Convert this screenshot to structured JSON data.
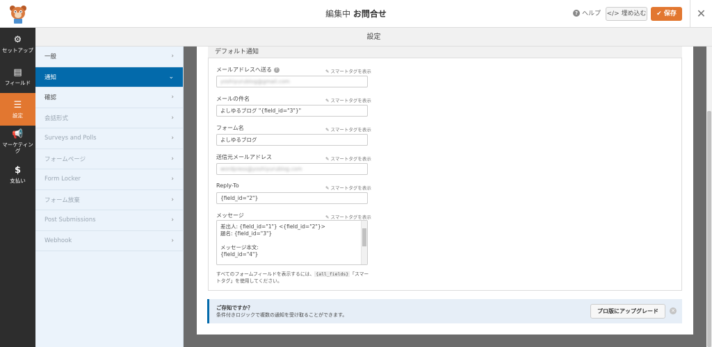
{
  "header": {
    "title_prefix": "編集中",
    "form_name": "お問合せ",
    "help_label": "ヘルプ",
    "embed_label": "</> 埋め込む",
    "save_label": "✔ 保存"
  },
  "sidebar": {
    "items": [
      {
        "icon": "⚙",
        "label": "セットアップ",
        "icon_name": "gear-icon"
      },
      {
        "icon": "▤",
        "label": "フィールド",
        "icon_name": "fields-list-icon"
      },
      {
        "icon": "☰",
        "label": "設定",
        "icon_name": "sliders-icon"
      },
      {
        "icon": "📢",
        "label": "マーケティング",
        "icon_name": "megaphone-icon"
      },
      {
        "icon": "$",
        "label": "支払い",
        "icon_name": "dollar-icon"
      }
    ],
    "active_index": 2
  },
  "subheader": {
    "label": "設定"
  },
  "panel": {
    "items": [
      {
        "label": "一般",
        "chev": "›"
      },
      {
        "label": "通知",
        "chev": "⌄"
      },
      {
        "label": "確認",
        "chev": "›"
      },
      {
        "label": "会話形式",
        "chev": "›"
      },
      {
        "label": "Surveys and Polls",
        "chev": "›"
      },
      {
        "label": "フォームページ",
        "chev": "›"
      },
      {
        "label": "Form Locker",
        "chev": "›"
      },
      {
        "label": "フォーム放棄",
        "chev": "›"
      },
      {
        "label": "Post Submissions",
        "chev": "›"
      },
      {
        "label": "Webhook",
        "chev": "›"
      }
    ]
  },
  "notification": {
    "heading": "デフォルト通知",
    "smart_tag_label": "スマートタグを表示",
    "fields": [
      {
        "label": "メールアドレスへ送る",
        "value": "yoshiyurublog@gmail.com"
      },
      {
        "label": "メールの件名",
        "value": "よしゆるブログ \"{field_id=\"3\"}\""
      },
      {
        "label": "フォーム名",
        "value": "よしゆるブログ"
      },
      {
        "label": "送信元メールアドレス",
        "value": "wordpress@yoshiyurublog.com"
      },
      {
        "label": "Reply-To",
        "value": "{field_id=\"2\"}"
      }
    ],
    "message": {
      "label": "メッセージ",
      "value": "差出人: {field_id=\"1\"} <{field_id=\"2\"}>\n題名: {field_id=\"3\"}\n\nメッセージ本文:\n{field_id=\"4\"}"
    },
    "note_before": "すべてのフォームフィールドを表示するには、",
    "note_code": "{all_fields}",
    "note_after": "「スマートタグ」を使用してください。"
  },
  "tip": {
    "title": "ご存知ですか？",
    "text": "条件付きロジックで複数の通知を受け取ることができます。",
    "button_label": "プロ版にアップグレード"
  },
  "colors": {
    "accent": "#e27730",
    "active_blue": "#036aab",
    "sidebar_bg": "#2d2d2d"
  }
}
